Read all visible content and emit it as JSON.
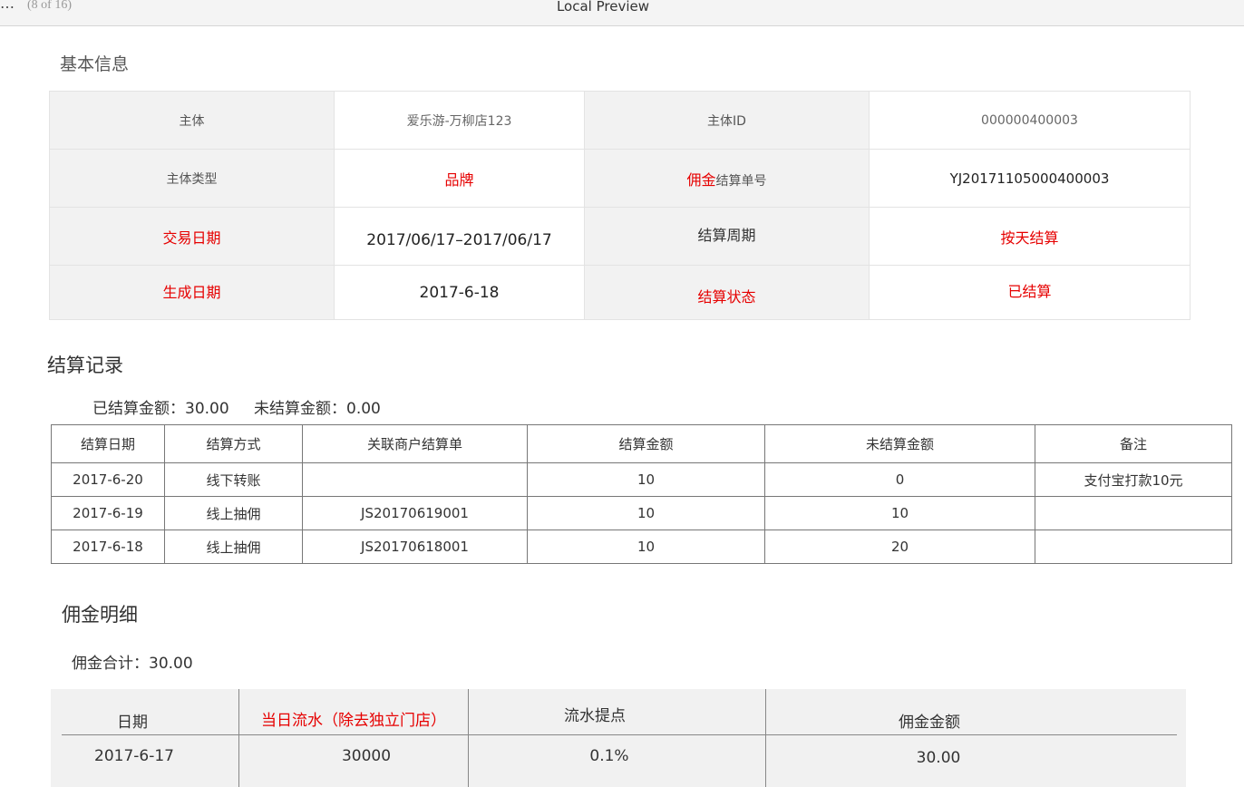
{
  "titlebar": {
    "dots": "…",
    "page_indicator": "(8 of 16)",
    "title": "Local Preview"
  },
  "basic_info": {
    "heading": "基本信息",
    "rows": [
      {
        "k1": "主体",
        "v1": "爱乐游-万柳店123",
        "k2": "主体ID",
        "v2": "000000400003"
      },
      {
        "k1": "主体类型",
        "v1": "品牌",
        "k2a": "佣金",
        "k2b": "结算单号",
        "v2": "YJ20171105000400003"
      },
      {
        "k1": "交易日期",
        "v1": "2017/06/17–2017/06/17",
        "k2": "结算周期",
        "v2": "按天结算"
      },
      {
        "k1": "生成日期",
        "v1": "2017-6-18",
        "k2": "结算状态",
        "v2": "已结算"
      }
    ]
  },
  "settlement": {
    "heading": "结算记录",
    "summary": {
      "settled": "已结算金额：30.00",
      "unsettled": "未结算金额：0.00"
    },
    "columns": [
      "结算日期",
      "结算方式",
      "关联商户结算单",
      "结算金额",
      "未结算金额",
      "备注"
    ],
    "rows": [
      [
        "2017-6-20",
        "线下转账",
        "",
        "10",
        "0",
        "支付宝打款10元"
      ],
      [
        "2017-6-19",
        "线上抽佣",
        "JS20170619001",
        "10",
        "10",
        ""
      ],
      [
        "2017-6-18",
        "线上抽佣",
        "JS20170618001",
        "10",
        "20",
        ""
      ]
    ]
  },
  "commission": {
    "heading": "佣金明细",
    "total": "佣金合计：30.00",
    "columns": [
      "日期",
      "当日流水（除去独立门店）",
      "流水提点",
      "佣金金额"
    ],
    "rows": [
      [
        "2017-6-17",
        "30000",
        "0.1%",
        "30.00"
      ]
    ]
  },
  "colors": {
    "accent_red": "#e60000",
    "header_gray": "#f2f2f2"
  }
}
